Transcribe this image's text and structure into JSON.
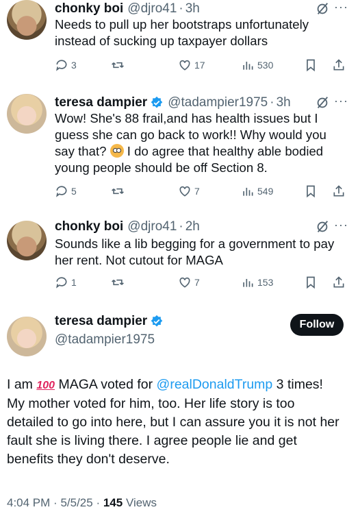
{
  "replies": [
    {
      "name": "chonky boi",
      "handle": "@djro41",
      "time": "3h",
      "text": "Needs to pull up her bootstraps unfortunately instead of sucking up taxpayer dollars",
      "replies": "3",
      "retweets": "",
      "likes": "17",
      "views": "530"
    },
    {
      "name": "teresa dampier",
      "handle": "@tadampier1975",
      "time": "3h",
      "text_before_emoji": "Wow! She's 88 frail,and has health issues but I guess she can go back to work!! Why would you say that? ",
      "text_after_emoji": " I do agree that healthy able bodied young people should be off Section 8.",
      "emoji": "flushed-face",
      "replies": "5",
      "retweets": "",
      "likes": "7",
      "views": "549"
    },
    {
      "name": "chonky boi",
      "handle": "@djro41",
      "time": "2h",
      "text": "Sounds like a lib begging for a government to pay her rent. Not cutout for MAGA",
      "replies": "1",
      "retweets": "",
      "likes": "7",
      "views": "153"
    }
  ],
  "main_post": {
    "name": "teresa dampier",
    "handle": "@tadampier1975",
    "follow_label": "Follow",
    "text_part1": "I am ",
    "emoji_100": "100",
    "text_part2": " MAGA voted for ",
    "mention": "@realDonaldTrump",
    "text_part3": " 3 times!  My mother voted for him, too. Her life story is too detailed to go into here, but I can assure you it is not her fault she is living there. I agree people lie and get benefits they don't deserve.",
    "time": "4:04 PM",
    "date": "5/5/25",
    "views_count": "145",
    "views_label": "Views"
  },
  "colors": {
    "text": "#0f1419",
    "secondary": "#536471",
    "accent": "#1d9bf0",
    "verified": "#1d9bf0"
  }
}
